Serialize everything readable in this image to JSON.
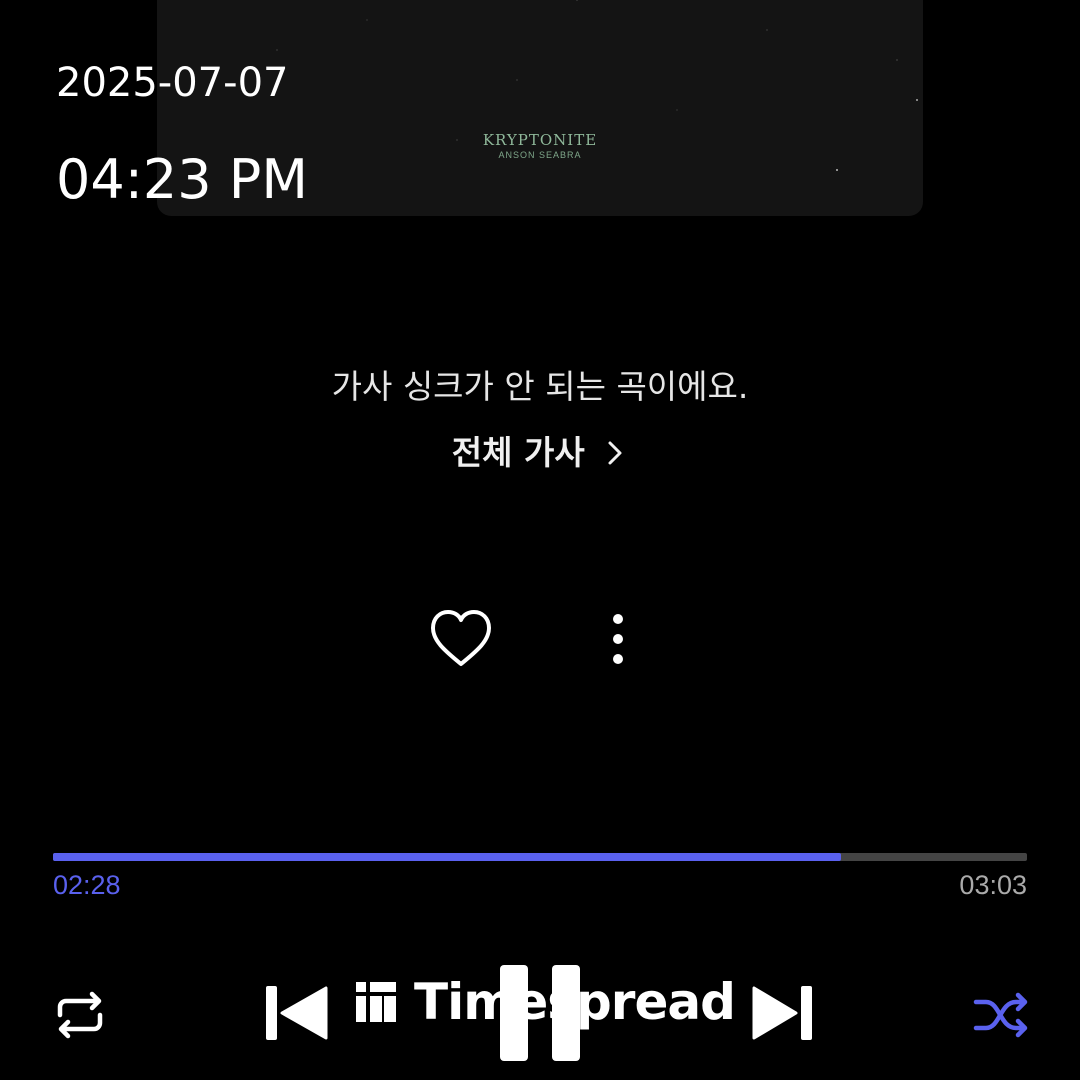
{
  "album": {
    "title": "KRYPTONITE",
    "artist": "ANSON SEABRA"
  },
  "overlay": {
    "date": "2025-07-07",
    "time": "04:23 PM"
  },
  "lyrics": {
    "message": "가사 싱크가 안 되는 곡이에요.",
    "full_lyrics_label": "전체 가사"
  },
  "actions": {
    "like_icon": "heart-icon",
    "more_icon": "more-vertical-icon"
  },
  "playback": {
    "elapsed": "02:28",
    "total": "03:03",
    "progress_fraction": 0.809
  },
  "controls": {
    "repeat_icon": "repeat-icon",
    "previous_icon": "skip-previous-icon",
    "pause_icon": "pause-icon",
    "next_icon": "skip-next-icon",
    "shuffle_icon": "shuffle-icon"
  },
  "watermark": {
    "text": "Timespread"
  },
  "colors": {
    "accent": "#5a61ee",
    "background": "#000000",
    "track": "#444444"
  }
}
